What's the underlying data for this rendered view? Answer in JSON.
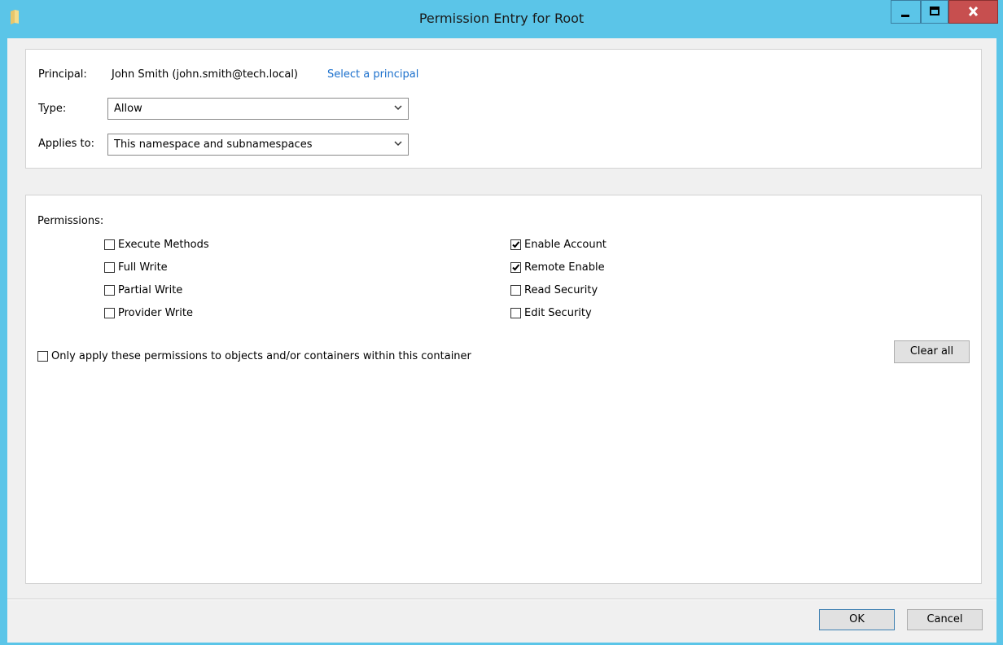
{
  "window": {
    "title": "Permission Entry for Root",
    "controls": {
      "minimize": "minimize",
      "maximize": "maximize",
      "close": "close"
    }
  },
  "principal": {
    "label": "Principal:",
    "value": "John Smith (john.smith@tech.local)",
    "link": "Select a principal"
  },
  "type": {
    "label": "Type:",
    "value": "Allow"
  },
  "applies_to": {
    "label": "Applies to:",
    "value": "This namespace and subnamespaces"
  },
  "permissions": {
    "heading": "Permissions:",
    "left": [
      {
        "label": "Execute Methods",
        "checked": false
      },
      {
        "label": "Full Write",
        "checked": false
      },
      {
        "label": "Partial Write",
        "checked": false
      },
      {
        "label": "Provider Write",
        "checked": false
      }
    ],
    "right": [
      {
        "label": "Enable Account",
        "checked": true
      },
      {
        "label": "Remote Enable",
        "checked": true
      },
      {
        "label": "Read Security",
        "checked": false
      },
      {
        "label": "Edit Security",
        "checked": false
      }
    ],
    "only_apply": {
      "label": "Only apply these permissions to objects and/or containers within this container",
      "checked": false
    },
    "clear_all": "Clear all"
  },
  "footer": {
    "ok": "OK",
    "cancel": "Cancel"
  },
  "colors": {
    "titlebar": "#5bc5e8",
    "link": "#1a6fcc",
    "close": "#c74f4f"
  }
}
